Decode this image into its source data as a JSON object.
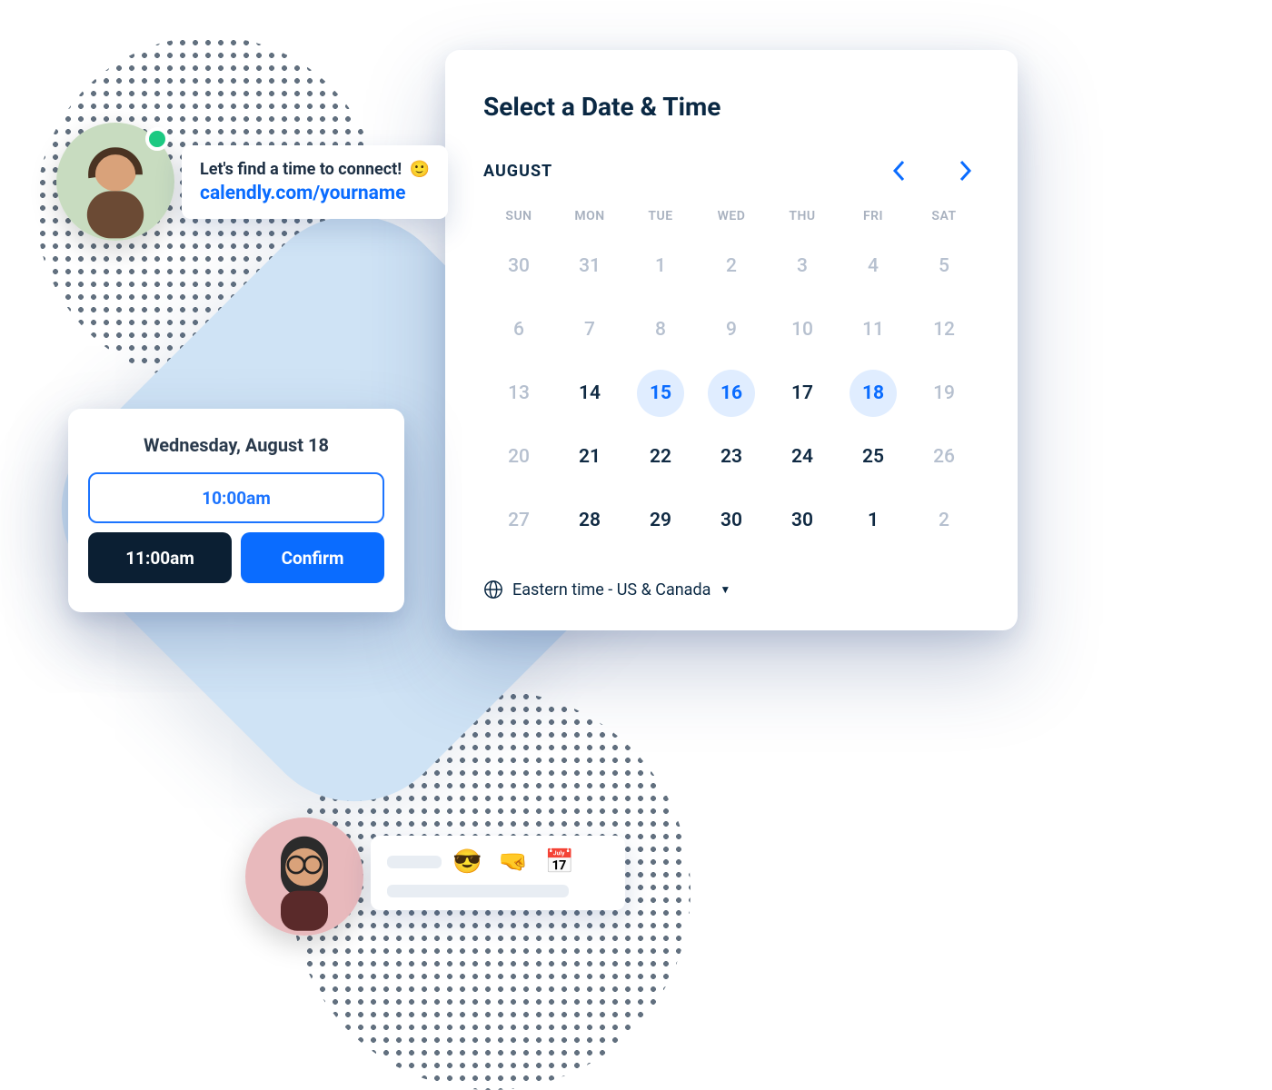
{
  "calendar": {
    "title": "Select a Date & Time",
    "month": "AUGUST",
    "day_headers": [
      "SUN",
      "MON",
      "TUE",
      "WED",
      "THU",
      "FRI",
      "SAT"
    ],
    "weeks": [
      [
        {
          "n": "30",
          "s": "muted"
        },
        {
          "n": "31",
          "s": "muted"
        },
        {
          "n": "1",
          "s": "muted"
        },
        {
          "n": "2",
          "s": "muted"
        },
        {
          "n": "3",
          "s": "muted"
        },
        {
          "n": "4",
          "s": "muted"
        },
        {
          "n": "5",
          "s": "muted"
        }
      ],
      [
        {
          "n": "6",
          "s": "muted"
        },
        {
          "n": "7",
          "s": "muted"
        },
        {
          "n": "8",
          "s": "muted"
        },
        {
          "n": "9",
          "s": "muted"
        },
        {
          "n": "10",
          "s": "muted"
        },
        {
          "n": "11",
          "s": "muted"
        },
        {
          "n": "12",
          "s": "muted"
        }
      ],
      [
        {
          "n": "13",
          "s": "muted"
        },
        {
          "n": "14",
          "s": "active"
        },
        {
          "n": "15",
          "s": "highlight"
        },
        {
          "n": "16",
          "s": "highlight"
        },
        {
          "n": "17",
          "s": "active"
        },
        {
          "n": "18",
          "s": "highlight"
        },
        {
          "n": "19",
          "s": "muted"
        }
      ],
      [
        {
          "n": "20",
          "s": "muted"
        },
        {
          "n": "21",
          "s": "active"
        },
        {
          "n": "22",
          "s": "active"
        },
        {
          "n": "23",
          "s": "active"
        },
        {
          "n": "24",
          "s": "active"
        },
        {
          "n": "25",
          "s": "active"
        },
        {
          "n": "26",
          "s": "muted"
        }
      ],
      [
        {
          "n": "27",
          "s": "muted"
        },
        {
          "n": "28",
          "s": "active"
        },
        {
          "n": "29",
          "s": "active"
        },
        {
          "n": "30",
          "s": "active"
        },
        {
          "n": "30",
          "s": "active"
        },
        {
          "n": "1",
          "s": "active"
        },
        {
          "n": "2",
          "s": "muted"
        }
      ]
    ],
    "timezone": "Eastern time - US & Canada"
  },
  "time_popover": {
    "date_label": "Wednesday, August 18",
    "slot_open": "10:00am",
    "slot_selected": "11:00am",
    "confirm_label": "Confirm"
  },
  "chat1": {
    "line1": "Let's find a time to connect!",
    "emoji": "🙂",
    "link": "calendly.com/yourname"
  },
  "chat2": {
    "emojis": "😎 🤜 📅"
  },
  "colors": {
    "accent": "#0a6cff",
    "dark": "#0a2843"
  }
}
